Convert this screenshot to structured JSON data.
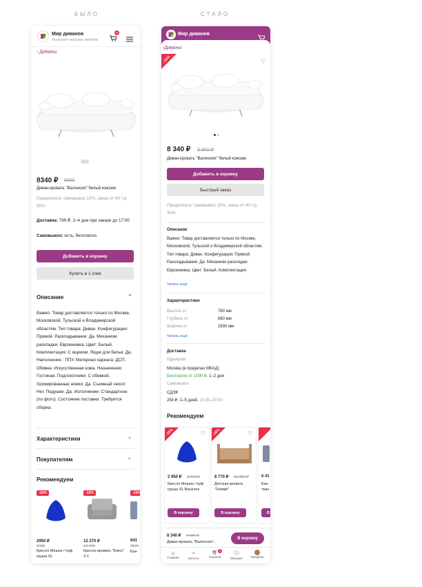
{
  "labels": {
    "before": "БЫЛО",
    "after": "СТАЛО"
  },
  "colors": {
    "brand": "#9b3a86",
    "discount": "#e8304a",
    "link": "#2f6ccf",
    "available": "#2e9a3a"
  },
  "old": {
    "brand_name": "Мир диванов",
    "brand_sub": "Интернет-магазин мебели",
    "cart_count": "8",
    "back": "Диваны",
    "price": "8340 ₽",
    "old_price": "9850",
    "title": "Диван-кровать \"Валенсия\" белый кожзам",
    "prepay": "Предоплата: самовывоз 10%, заказ от 40 т.р. 30%",
    "delivery_label": "Доставка:",
    "delivery_text": "799 ₽, 2–4 дня при заказе до 17:00",
    "pickup_label": "Самовывоз:",
    "pickup_text": "есть, бесплатно",
    "add_cart": "Добавить в корзину",
    "buy_one": "Купить в 1 клик",
    "desc_heading": "Описание",
    "description": "Важно: Товар доставляется только по Москве, Московской, Тульской и Владимирской областям. Тип товара: Диван. Конфигурация: Прямой. Раскладывание: Да. Механизм раскладки: Еврокнижка. Цвет: Белый. Комплектация: С ящиком. Ящик для белья: Да. Наполнение : ППУ. Материал каркаса: ДСП. Обивка: Искусственная кожа. Назначение: Гостиная. Подлокотники: С обивкой. Хромированные ножки: Да. Съемный чехол: Нет. Подушки: Да. Исполнение: Стандартное (по фото). Состояние поставки: Требуется сборка.",
    "specs_heading": "Характеристики",
    "buyers_heading": "Покупателям",
    "recommend_heading": "Рекомендуем",
    "products": [
      {
        "badge": "-15%",
        "price": "2950 ₽",
        "old": "3400",
        "name": "Кресло Мешок / пуф груша XL"
      },
      {
        "badge": "-15%",
        "price": "12 270 ₽",
        "old": "14 450",
        "name": "Кресло-кровать \"Блюз\" 3-1"
      },
      {
        "badge": "-15%",
        "price": "641",
        "old": "7570",
        "name": "Бан"
      }
    ]
  },
  "new": {
    "brand_name": "Мир диванов",
    "back": "Диваны",
    "badge": "-15%",
    "price": "8 340 ₽",
    "old_price": "8 850 ₽",
    "title": "Диван-кровать \"Валенсия\" белый кожзам",
    "add_cart": "Добавить в корзину",
    "quick_order": "Быстрый заказ",
    "prepay": "Предоплата: самовывоз 10%, заказ от 40 т.р. 30%",
    "desc_heading": "Описание",
    "description": "Важно: Товар доставляется только по Москве, Московской, Тульской и Владимирской областям. Тип товара: Диван. Конфигурация: Прямой. Раскладывание: Да. Механизм раскладки: Еврокнижка. Цвет: Белый. Комплектация:",
    "read_more": "Читать ещё",
    "specs_heading": "Характеристики",
    "specs": [
      {
        "k": "Высота от",
        "v": "780 мм"
      },
      {
        "k": "Глубина от",
        "v": "880 мм"
      },
      {
        "k": "Ширина от",
        "v": "1830 мм"
      }
    ],
    "delivery_heading": "Доставка",
    "courier": "Курьером",
    "courier_city": "Москва (в пределах МКАД)",
    "courier_free": "Бесплатно от 1000 ₽,",
    "courier_days": "1–2 дня",
    "pickup": "Самовывоз",
    "pickup_point": "СДЭК",
    "pickup_price": "254 ₽, 1–5 дней.",
    "pickup_hours": "10:00–20:00",
    "recommend_heading": "Рекомендуем",
    "products": [
      {
        "badge": "-10%",
        "price": "2 950 ₽",
        "old": "3 400 ₽",
        "name": "Кресло Мешок / пуф груша XL Василек",
        "cta": "В корзину"
      },
      {
        "badge": "-10%",
        "price": "8 770 ₽",
        "old": "10 350 ₽",
        "name": "Детская кровать \"Олимп\"",
        "cta": "В корзину"
      },
      {
        "badge": "-10%",
        "price": "6 41",
        "old": "",
        "name": "Бан ткан",
        "cta": "В"
      }
    ],
    "sticky_price": "8 340 ₽",
    "sticky_old": "9 850 ₽",
    "sticky_name": "Диван-кровать \"Валенсия\"...",
    "sticky_cta": "В корзину",
    "cart_count": "3",
    "nav": [
      "Главная",
      "Каталог",
      "Корзина",
      "Магазин",
      "Профиль"
    ]
  }
}
